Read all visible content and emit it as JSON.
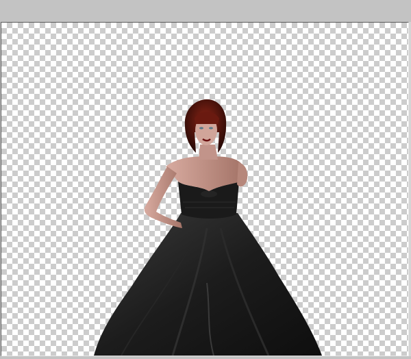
{
  "window": {
    "workspace_color": "#c3c3c3"
  },
  "canvas": {
    "transparency_pattern": "checkerboard",
    "checker_colors": [
      "#ffffff",
      "#cccccc"
    ]
  },
  "layer": {
    "subject": "woman-in-black-ball-gown",
    "hair_color": "#7a1a10",
    "dress_color": "#1e1e1e",
    "skin_color": "#c99a8e"
  }
}
